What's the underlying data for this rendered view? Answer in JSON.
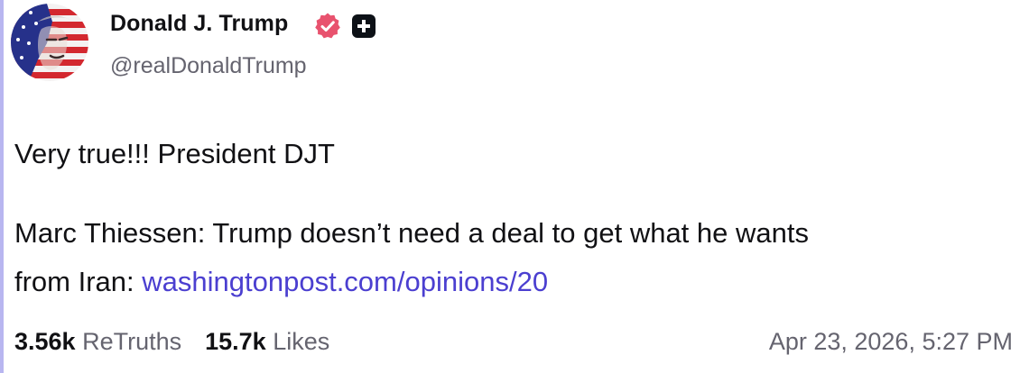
{
  "author": {
    "name": "Donald J. Trump",
    "handle": "@realDonaldTrump"
  },
  "post": {
    "line1": "Very true!!! President DJT",
    "line2": "Marc Thiessen: Trump doesn’t need a deal to get what he wants",
    "line3_prefix": "from Iran: ",
    "link_text": "washingtonpost.com/opinions/20"
  },
  "stats": {
    "retruths_count": "3.56k",
    "retruths_label": "ReTruths",
    "likes_count": "15.7k",
    "likes_label": "Likes"
  },
  "timestamp": "Apr 23, 2026, 5:27 PM",
  "colors": {
    "accent_border": "#b8b6f0",
    "link": "#4b3fd0",
    "verified": "#e8526e",
    "muted_text": "#65646f"
  },
  "icons": {
    "avatar": "avatar-flag-portrait",
    "verified": "verified-badge-icon",
    "plus": "plus-badge-icon"
  }
}
